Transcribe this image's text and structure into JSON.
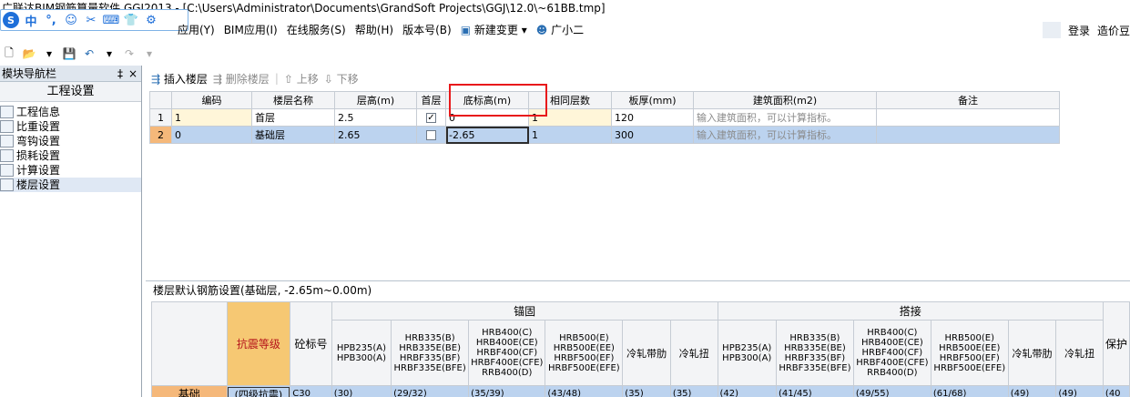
{
  "window": {
    "title": "广联达BIM钢筋算量软件 GGJ2013 - [C:\\Users\\Administrator\\Documents\\GrandSoft Projects\\GGJ\\12.0\\~61BB.tmp]"
  },
  "ime": {
    "logo": "S",
    "mode": "中",
    "icons": [
      "°,",
      "☺",
      "✂",
      "⌨",
      "👕",
      "⚙"
    ]
  },
  "menu": {
    "items": [
      "应用(Y)",
      "BIM应用(I)",
      "在线服务(S)",
      "帮助(H)",
      "版本号(B)",
      "新建变更",
      "广小二"
    ],
    "right": [
      "登录",
      "造价豆"
    ]
  },
  "left_panel": {
    "title": "模块导航栏",
    "pin": "‡",
    "close": "×",
    "section": "工程设置",
    "items": [
      "工程信息",
      "比重设置",
      "弯钩设置",
      "损耗设置",
      "计算设置",
      "楼层设置"
    ]
  },
  "floor_toolbar": {
    "insert": "插入楼层",
    "delete": "删除楼层",
    "up": "上移",
    "down": "下移"
  },
  "floor_table": {
    "headers": [
      "编码",
      "楼层名称",
      "层高(m)",
      "首层",
      "底标高(m)",
      "相同层数",
      "板厚(mm)",
      "建筑面积(m2)",
      "备注"
    ],
    "rows": [
      {
        "num": "1",
        "code": "1",
        "name": "首层",
        "height": "2.5",
        "first": "✓",
        "bottom": "0",
        "same": "1",
        "thick": "120",
        "area": "输入建筑面积，可以计算指标。",
        "note": ""
      },
      {
        "num": "2",
        "code": "0",
        "name": "基础层",
        "height": "2.65",
        "first": "",
        "bottom": "-2.65",
        "same": "1",
        "thick": "300",
        "area": "输入建筑面积，可以计算指标。",
        "note": ""
      }
    ]
  },
  "rebar_settings": {
    "title": "楼层默认钢筋设置(基础层, -2.65m~0.00m)",
    "group_anchor": "锚固",
    "group_lap": "搭接",
    "col_grade": "抗震等级",
    "col_concrete": "砼标号",
    "col_protect": "保护",
    "sub_headers": [
      "HPB235(A)\nHPB300(A)",
      "HRB335(B)\nHRB335E(BE)\nHRBF335(BF)\nHRBF335E(BFE)",
      "HRB400(C)\nHRB400E(CE)\nHRBF400(CF)\nHRBF400E(CFE)\nRRB400(D)",
      "HRB500(E)\nHRB500E(EE)\nHRBF500(EF)\nHRBF500E(EFE)",
      "冷轧带肋",
      "冷轧扭"
    ],
    "row": {
      "name": "基础",
      "grade": "(四级抗震)",
      "concrete": "C30",
      "anchor": [
        "(30)",
        "(29/32)",
        "(35/39)",
        "(43/48)",
        "(35)",
        "(35)"
      ],
      "lap": [
        "(42)",
        "(41/45)",
        "(49/55)",
        "(61/68)",
        "(49)",
        "(49)"
      ],
      "protect": "(40"
    }
  }
}
